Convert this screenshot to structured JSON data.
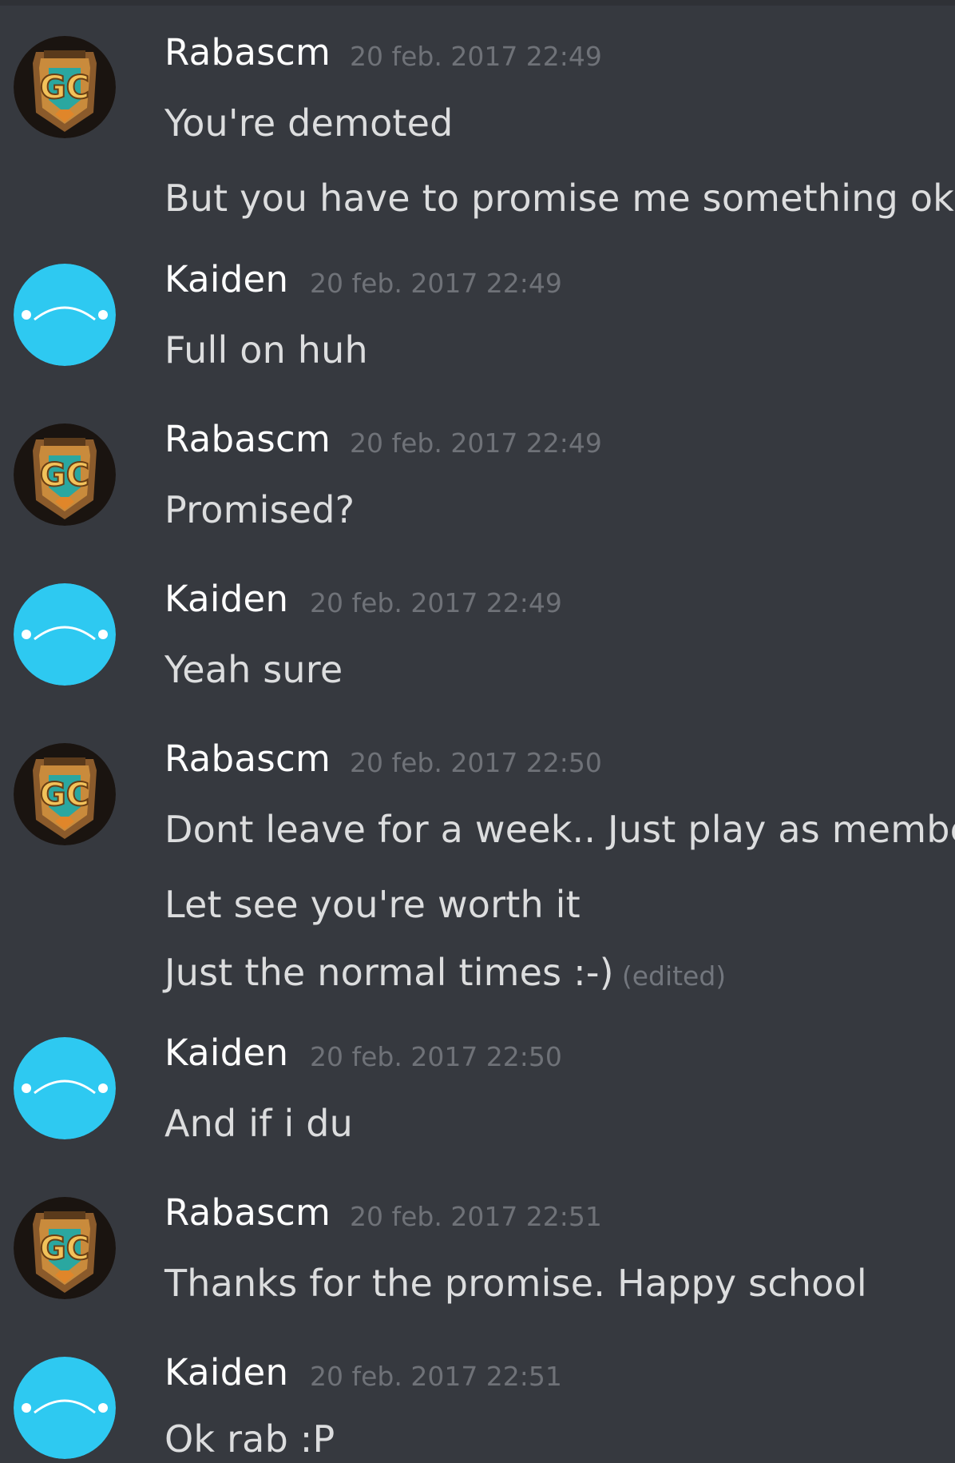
{
  "messages": [
    {
      "author": "Rabascm",
      "timestamp": "20 feb. 2017 22:49",
      "lines": [
        "You're demoted",
        "But you have to promise me something okay"
      ]
    },
    {
      "author": "Kaiden",
      "timestamp": "20 feb. 2017 22:49",
      "lines": [
        "Full on huh"
      ]
    },
    {
      "author": "Rabascm",
      "timestamp": "20 feb. 2017 22:49",
      "lines": [
        "Promised?"
      ]
    },
    {
      "author": "Kaiden",
      "timestamp": "20 feb. 2017 22:49",
      "lines": [
        "Yeah sure"
      ]
    },
    {
      "author": "Rabascm",
      "timestamp": "20 feb. 2017 22:50",
      "lines": [
        "Dont leave for a week.. Just play as member",
        "Let see you're worth it",
        "Just the normal times :-)"
      ],
      "edited_label": "(edited)"
    },
    {
      "author": "Kaiden",
      "timestamp": "20 feb. 2017 22:50",
      "lines": [
        "And if i du"
      ]
    },
    {
      "author": "Rabascm",
      "timestamp": "20 feb. 2017 22:51",
      "lines": [
        "Thanks for the promise. Happy school"
      ]
    },
    {
      "author": "Kaiden",
      "timestamp": "20 feb. 2017 22:51",
      "lines": [
        "Ok rab :P"
      ]
    }
  ],
  "colors": {
    "background": "#36393f",
    "username": "#ffffff",
    "timestamp": "#6f7278",
    "message_text": "#dcddde",
    "kaiden_avatar": "#2ec9f1"
  },
  "icons": {
    "rabascm_avatar": "gc-shield-emblem-icon",
    "kaiden_avatar": "frown-face-icon"
  }
}
